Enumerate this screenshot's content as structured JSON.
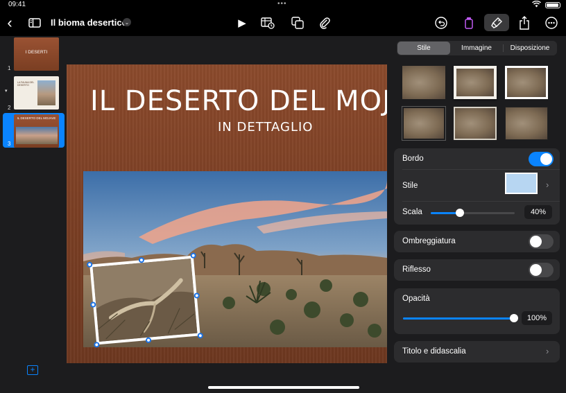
{
  "status": {
    "time": "09:41",
    "dots": "•••"
  },
  "toolbar": {
    "back": "‹",
    "doc_title": "Il bioma desertico",
    "title_chevron": "⌄",
    "play": "▶"
  },
  "navigator": {
    "slides": [
      {
        "num": "1",
        "title": "I DESERTI"
      },
      {
        "num": "2",
        "title": "LA FAUNA DEL DESERTO"
      },
      {
        "num": "3",
        "title": "IL DESERTO DEL MOJAVE"
      }
    ],
    "expand": "▾",
    "add": "+"
  },
  "slide": {
    "title": "IL DESERTO DEL MOJAVE",
    "subtitle": "IN DETTAGLIO"
  },
  "inspector": {
    "tabs": [
      {
        "label": "Stile",
        "active": true
      },
      {
        "label": "Immagine",
        "active": false
      },
      {
        "label": "Disposizione",
        "active": false
      }
    ],
    "border": {
      "label": "Bordo",
      "on": true
    },
    "style": {
      "label": "Stile",
      "chevron": "›"
    },
    "scale": {
      "label": "Scala",
      "value": "40%",
      "level": 0.35
    },
    "shadow": {
      "label": "Ombreggiatura",
      "on": false
    },
    "reflection": {
      "label": "Riflesso",
      "on": false
    },
    "opacity": {
      "label": "Opacità",
      "value": "100%",
      "level": 1.0
    },
    "caption": {
      "label": "Titolo e didascalia",
      "chevron": "›"
    }
  },
  "colors": {
    "accent": "#0a84ff",
    "slide_bg": "#7b3f24"
  }
}
